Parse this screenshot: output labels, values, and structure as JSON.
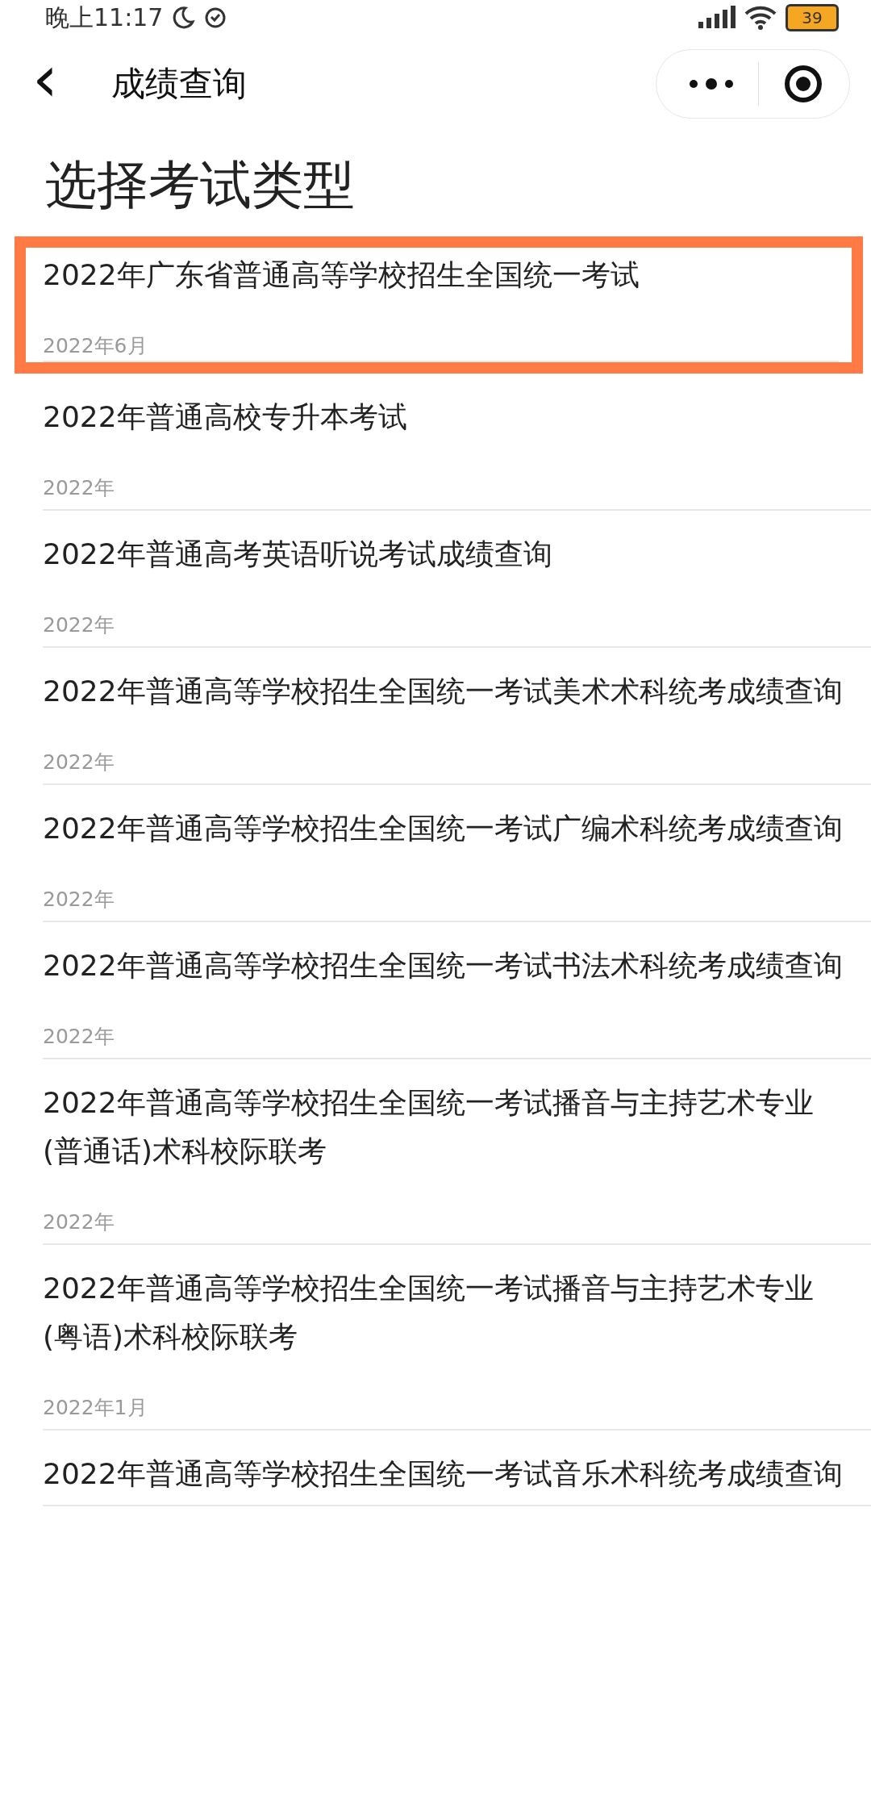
{
  "status_bar": {
    "time": "晚上11:17",
    "battery": "39"
  },
  "header": {
    "back": "‹",
    "title": "成绩查询"
  },
  "heading": "选择考试类型",
  "exams": [
    {
      "title": "2022年广东省普通高等学校招生全国统一考试",
      "date": "2022年6月",
      "selected": true
    },
    {
      "title": "2022年普通高校专升本考试",
      "date": "2022年",
      "selected": false
    },
    {
      "title": "2022年普通高考英语听说考试成绩查询",
      "date": "2022年",
      "selected": false
    },
    {
      "title": "2022年普通高等学校招生全国统一考试美术术科统考成绩查询",
      "date": "2022年",
      "selected": false
    },
    {
      "title": "2022年普通高等学校招生全国统一考试广编术科统考成绩查询",
      "date": "2022年",
      "selected": false
    },
    {
      "title": "2022年普通高等学校招生全国统一考试书法术科统考成绩查询",
      "date": "2022年",
      "selected": false
    },
    {
      "title": "2022年普通高等学校招生全国统一考试播音与主持艺术专业 (普通话)术科校际联考",
      "date": "2022年",
      "selected": false
    },
    {
      "title": "2022年普通高等学校招生全国统一考试播音与主持艺术专业 (粤语)术科校际联考",
      "date": "2022年1月",
      "selected": false
    },
    {
      "title": "2022年普通高等学校招生全国统一考试音乐术科统考成绩查询",
      "selected": false
    }
  ]
}
